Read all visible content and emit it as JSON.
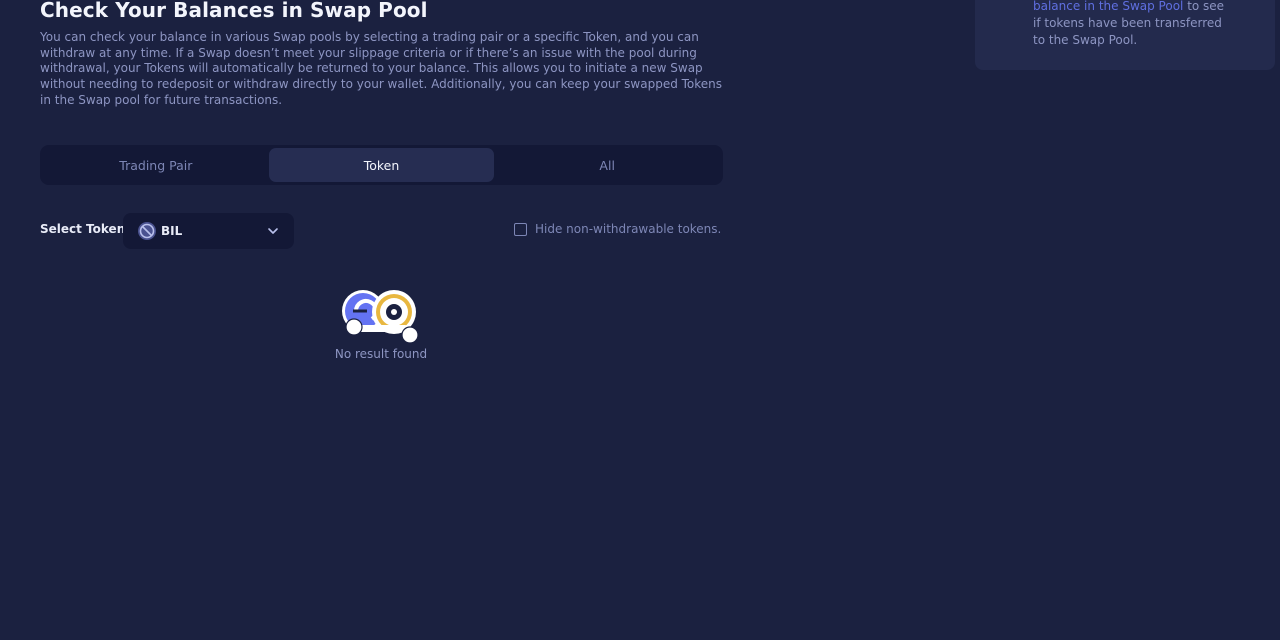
{
  "header": {
    "title": "Check Your Balances in Swap Pool",
    "description": "You can check your balance in various Swap pools by selecting a trading pair or a specific Token, and you can withdraw at any time. If a Swap doesn’t meet your slippage criteria or if there’s an issue with the pool during withdrawal, your Tokens will automatically be returned to your balance. This allows you to initiate a new Swap without needing to redeposit or withdraw directly to your wallet. Additionally, you can keep your swapped Tokens in the Swap pool for future transactions."
  },
  "side_card": {
    "link_text": "balance in the Swap Pool",
    "text_after": " to see if tokens have been transferred to the Swap Pool."
  },
  "tabs": [
    {
      "label": "Trading Pair",
      "active": false
    },
    {
      "label": "Token",
      "active": true
    },
    {
      "label": "All",
      "active": false
    }
  ],
  "token_selector": {
    "label": "Select Token",
    "selected": "BIL",
    "icon": "blocked-circle-icon"
  },
  "filter": {
    "hide_label": "Hide non-withdrawable tokens.",
    "checked": false
  },
  "empty_state": {
    "message": "No result found",
    "icon": "no-result-illustration"
  },
  "colors": {
    "background": "#1b2140",
    "panel": "#131836",
    "active_tab": "#262d52",
    "card": "#232a4d",
    "link": "#5f6fe0",
    "muted_text": "#8d95c2"
  }
}
